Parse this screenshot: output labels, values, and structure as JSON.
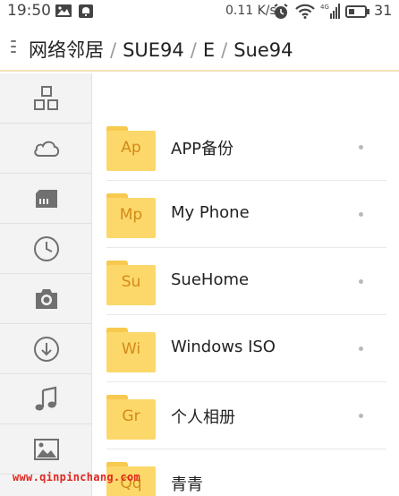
{
  "status_bar": {
    "time": "19:50",
    "network_speed": "0.11 K/s",
    "signal_label": "4G",
    "battery_level": "31",
    "icons": [
      "image-icon",
      "notification-icon",
      "alarm-icon",
      "wifi-icon",
      "signal-icon",
      "battery-icon"
    ]
  },
  "header": {
    "menu_icon": "menu-handle-icon",
    "breadcrumb": [
      "网络邻居",
      "SUE94",
      "E",
      "Sue94"
    ],
    "separator": "/"
  },
  "sidebar": {
    "items": [
      {
        "icon": "category-icon"
      },
      {
        "icon": "cloud-icon"
      },
      {
        "icon": "sd-card-icon"
      },
      {
        "icon": "clock-icon"
      },
      {
        "icon": "camera-icon"
      },
      {
        "icon": "download-icon"
      },
      {
        "icon": "music-icon"
      },
      {
        "icon": "picture-icon"
      }
    ]
  },
  "files": [
    {
      "abbr": "Ap",
      "name": "APP备份"
    },
    {
      "abbr": "Mp",
      "name": "My Phone"
    },
    {
      "abbr": "Su",
      "name": "SueHome"
    },
    {
      "abbr": "Wi",
      "name": "Windows ISO"
    },
    {
      "abbr": "Gr",
      "name": "个人相册"
    },
    {
      "abbr": "Qq",
      "name": "青青"
    }
  ],
  "watermark": "www.qinpinchang.com",
  "colors": {
    "folder": "#fcd86a",
    "folder_text": "#d28a19",
    "header_border": "#f2e3b5",
    "sidebar_bg": "#f3f3f3",
    "watermark": "#e0261e"
  }
}
